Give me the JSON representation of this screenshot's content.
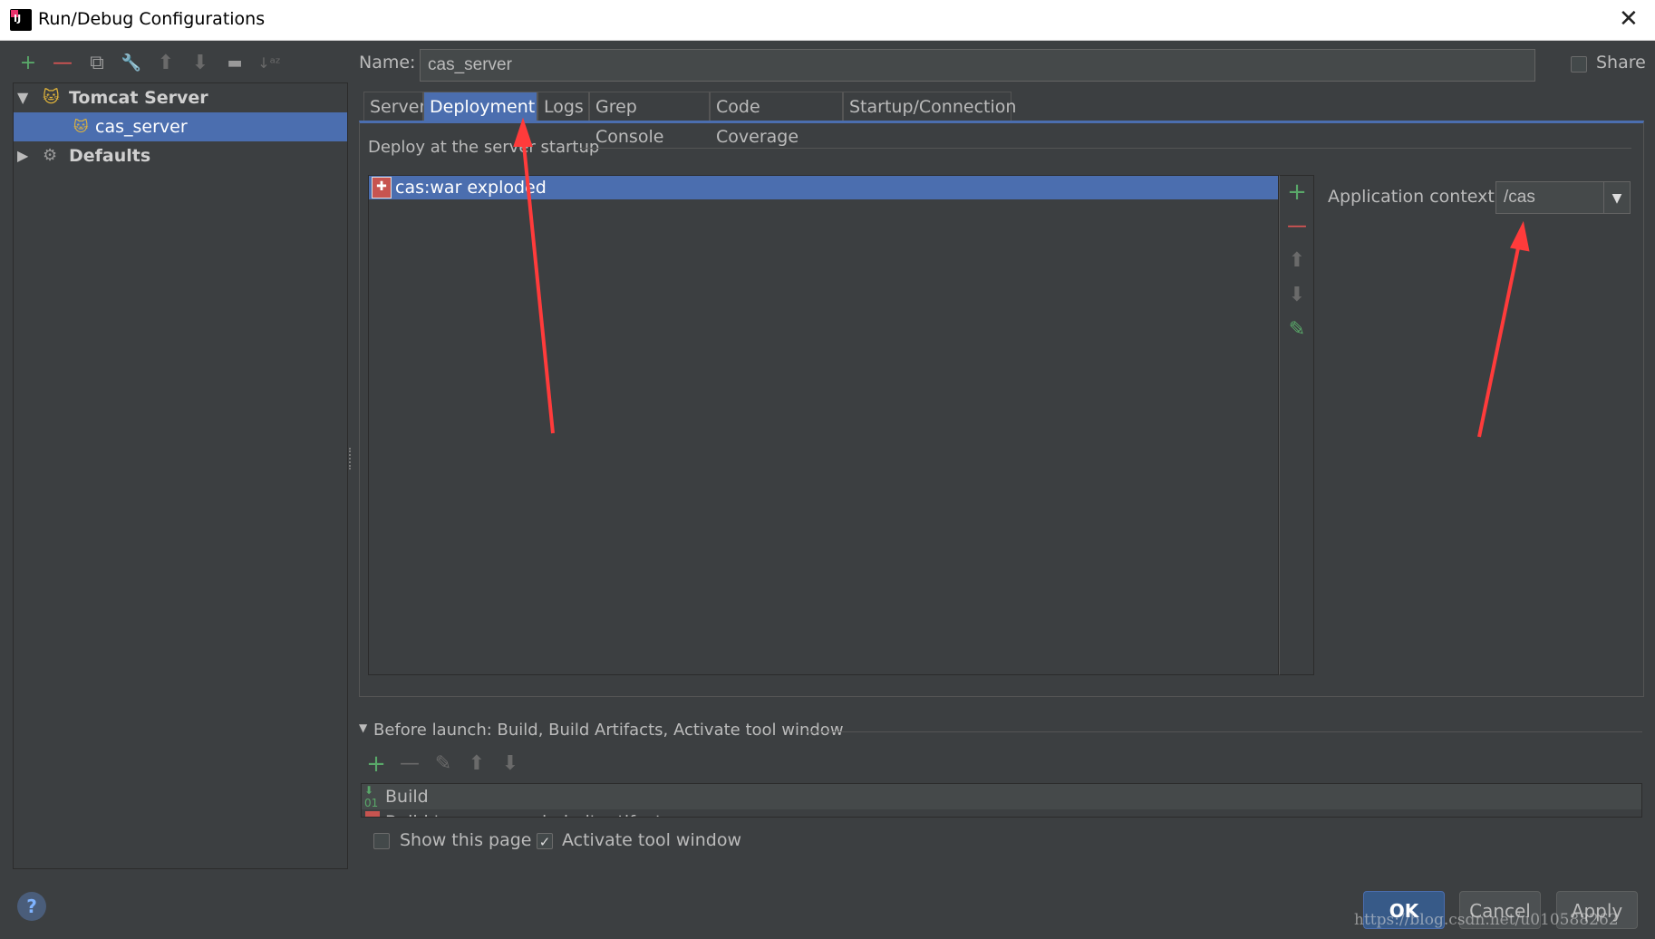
{
  "window": {
    "title": "Run/Debug Configurations",
    "close": "✕"
  },
  "toolbar": [
    "+",
    "—",
    "⧉",
    "🔧",
    "⬆",
    "⬇",
    "▬",
    "↓ᵃᶻ"
  ],
  "tree": {
    "items": [
      {
        "label": "Tomcat Server",
        "expand": "▼"
      },
      {
        "label": "cas_server"
      },
      {
        "label": "Defaults",
        "expand": "▶"
      }
    ]
  },
  "name": {
    "label": "Name:",
    "value": "cas_server"
  },
  "share": {
    "label": "Share",
    "checked": false
  },
  "tabs": [
    "Server",
    "Deployment",
    "Logs",
    "Grep Console",
    "Code Coverage",
    "Startup/Connection"
  ],
  "deployment": {
    "section_label": "Deploy at the server startup",
    "items": [
      "cas:war exploded"
    ],
    "side_buttons": [
      "+",
      "—",
      "⬆",
      "⬇",
      "✎"
    ],
    "context_label": "Application context:",
    "context_value": "/cas",
    "context_dropdown": "▼"
  },
  "before_launch": {
    "label": "Before launch: Build, Build Artifacts, Activate tool window",
    "toggle": "▼",
    "toolbar": [
      "+",
      "—",
      "✎",
      "⬆",
      "⬇"
    ],
    "items": [
      "Build",
      "Build 'cas:war exploded' artifact"
    ]
  },
  "options": {
    "show_page": {
      "label": "Show this page",
      "checked": false
    },
    "activate_tool": {
      "label": "Activate tool window",
      "checked": true,
      "mark": "✓"
    }
  },
  "help": "?",
  "buttons": {
    "ok": "OK",
    "cancel": "Cancel",
    "apply": "Apply"
  },
  "watermark": "https://blog.csdn.net/u010588262",
  "colors": {
    "accent": "#4b6eaf",
    "annotation": "#ff3b3b",
    "add_green": "#59a869",
    "remove_red": "#e05555"
  }
}
